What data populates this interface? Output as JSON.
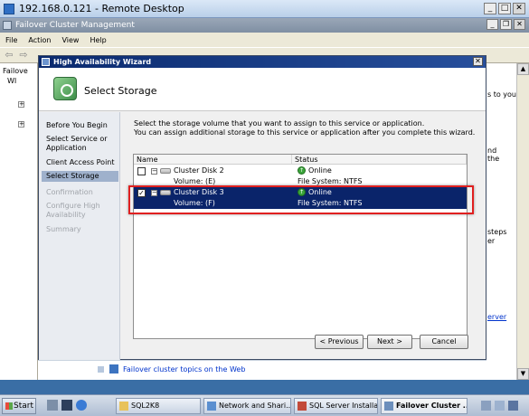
{
  "remote_desktop": {
    "title": "192.168.0.121 - Remote Desktop",
    "minimize": "_",
    "maximize": "□",
    "close": "✕"
  },
  "mmc": {
    "title": "Failover Cluster Management",
    "minimize": "_",
    "restore": "❐",
    "close": "✕",
    "menu": [
      "File",
      "Action",
      "View",
      "Help"
    ],
    "tree_root": "Failove",
    "tree_wi": "WI",
    "right_fragments": [
      "s to you",
      "nd",
      "the",
      "steps",
      "er",
      "erver"
    ],
    "bottom_link": "Failover cluster topics on the Web"
  },
  "wizard": {
    "title": "High Availability Wizard",
    "close": "✕",
    "header_title": "Select Storage",
    "steps": [
      {
        "label": "Before You Begin",
        "state": "normal"
      },
      {
        "label": "Select Service or Application",
        "state": "normal"
      },
      {
        "label": "Client Access Point",
        "state": "normal"
      },
      {
        "label": "Select Storage",
        "state": "active"
      },
      {
        "label": "Confirmation",
        "state": "disabled"
      },
      {
        "label": "Configure High Availability",
        "state": "disabled"
      },
      {
        "label": "Summary",
        "state": "disabled"
      }
    ],
    "instruction_line1": "Select the storage volume that you want to assign to this service or application.",
    "instruction_line2": "You can assign additional storage to this service or application after you complete this wizard.",
    "columns": {
      "name": "Name",
      "status": "Status"
    },
    "disks": [
      {
        "name": "Cluster Disk 2",
        "volume": "Volume: (E)",
        "status": "Online",
        "fs": "File System: NTFS",
        "checked": false,
        "selected": false
      },
      {
        "name": "Cluster Disk 3",
        "volume": "Volume: (F)",
        "status": "Online",
        "fs": "File System: NTFS",
        "checked": true,
        "selected": true
      }
    ],
    "buttons": {
      "previous": "< Previous",
      "next": "Next >",
      "cancel": "Cancel"
    }
  },
  "taskbar": {
    "start": "Start",
    "tasks": [
      {
        "label": "SQL2K8",
        "active": false
      },
      {
        "label": "Network and Shari...",
        "active": false
      },
      {
        "label": "SQL Server Installa...",
        "active": false
      },
      {
        "label": "Failover Cluster ...",
        "active": true
      }
    ]
  },
  "colors": {
    "selection": "#0a246a",
    "highlight_box": "#e02020",
    "online": "#3ba53b"
  }
}
